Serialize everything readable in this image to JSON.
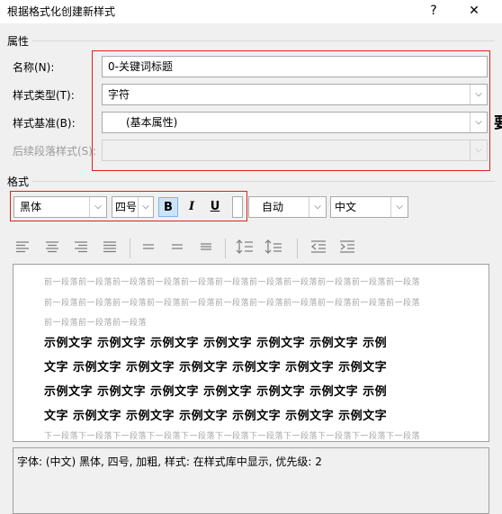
{
  "window": {
    "title": "根据格式化创建新样式",
    "help": "?",
    "close": "✕"
  },
  "properties": {
    "section": "属性",
    "name_label": "名称(N):",
    "name_value": "0-关键词标题",
    "type_label": "样式类型(T):",
    "type_value": "字符",
    "based_label": "样式基准(B):",
    "based_value": "(基本属性)",
    "next_label": "后续段落样式(S):",
    "next_value": ""
  },
  "format": {
    "section": "格式",
    "font": "黑体",
    "size": "四号",
    "bold": "B",
    "italic": "I",
    "underline": "U",
    "color": "自动",
    "lang": "中文"
  },
  "preview": {
    "prev_para_1": "前一段落前一段落前一段落前一段落前一段落前一段落前一段落前一段落前一段落前一段落前一段落",
    "prev_para_2": "前一段落前一段落前一段落前一段落前一段落前一段落前一段落前一段落前一段落前一段落前一段落",
    "prev_para_3": "前一段落前一段落前一段落",
    "sample_1": "示例文字 示例文字 示例文字 示例文字 示例文字 示例文字 示例",
    "sample_2": "文字 示例文字 示例文字 示例文字 示例文字 示例文字 示例文字",
    "sample_3": "示例文字 示例文字 示例文字 示例文字 示例文字 示例文字 示例",
    "sample_4": "文字 示例文字 示例文字 示例文字 示例文字 示例文字 示例文字",
    "next_para_1": "下一段落下一段落下一段落下一段落下一段落下一段落下一段落下一段落下一段落下一段落下一段落"
  },
  "description": "字体: (中文) 黑体, 四号, 加粗, 样式: 在样式库中显示, 优先级: 2",
  "background_glyph": "要",
  "icons": [
    "align-left-icon",
    "align-center-icon",
    "align-right-icon",
    "justify-icon",
    "distributed-icon",
    "line-spacing-icon",
    "line-spacing-small-icon",
    "decrease-indent-icon",
    "increase-indent-icon"
  ],
  "colors": {
    "highlight_red": "#e02020",
    "active_button": "#cce4f7"
  }
}
